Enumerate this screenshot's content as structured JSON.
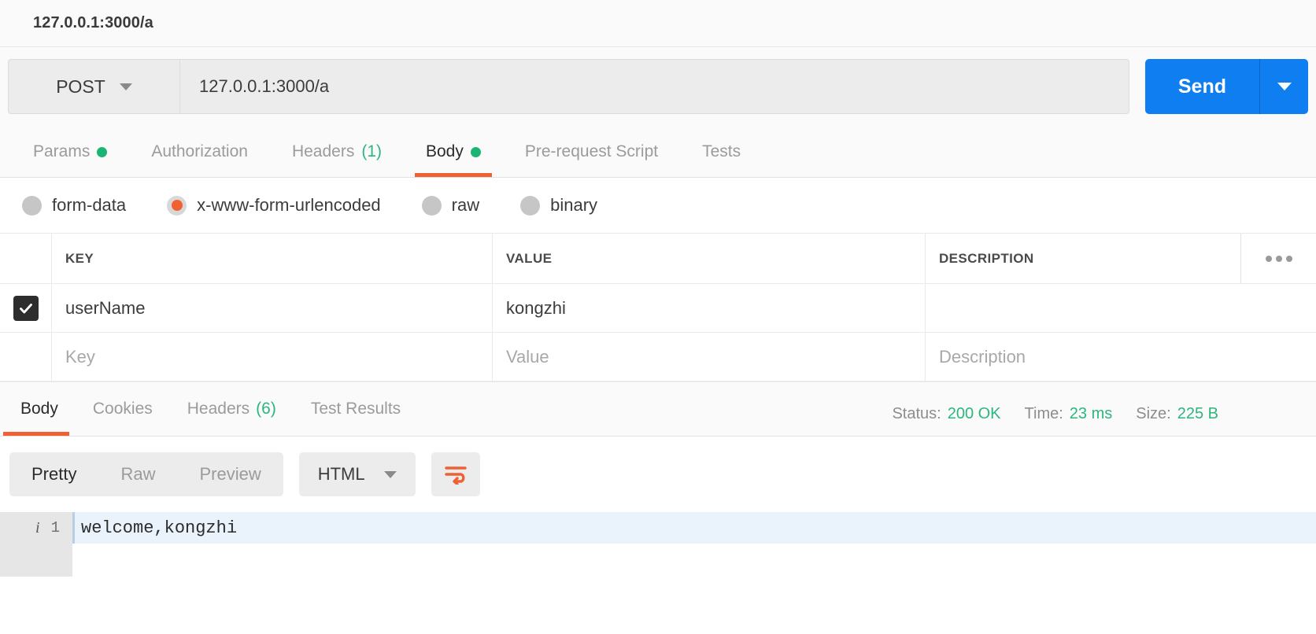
{
  "titlebar": {
    "text": "127.0.0.1:3000/a"
  },
  "request": {
    "method": "POST",
    "url": "127.0.0.1:3000/a",
    "send_label": "Send",
    "tabs": [
      {
        "label": "Params",
        "dot": true,
        "count": "",
        "active": false
      },
      {
        "label": "Authorization",
        "dot": false,
        "count": "",
        "active": false
      },
      {
        "label": "Headers",
        "dot": false,
        "count": "(1)",
        "active": false
      },
      {
        "label": "Body",
        "dot": true,
        "count": "",
        "active": true
      },
      {
        "label": "Pre-request Script",
        "dot": false,
        "count": "",
        "active": false
      },
      {
        "label": "Tests",
        "dot": false,
        "count": "",
        "active": false
      }
    ],
    "body_types": [
      {
        "label": "form-data",
        "selected": false
      },
      {
        "label": "x-www-form-urlencoded",
        "selected": true
      },
      {
        "label": "raw",
        "selected": false
      },
      {
        "label": "binary",
        "selected": false
      }
    ],
    "table": {
      "headers": {
        "key": "KEY",
        "value": "VALUE",
        "description": "DESCRIPTION"
      },
      "rows": [
        {
          "checked": true,
          "key": "userName",
          "value": "kongzhi",
          "description": ""
        }
      ],
      "placeholders": {
        "key": "Key",
        "value": "Value",
        "description": "Description"
      }
    }
  },
  "response": {
    "tabs": [
      {
        "label": "Body",
        "count": "",
        "active": true
      },
      {
        "label": "Cookies",
        "count": "",
        "active": false
      },
      {
        "label": "Headers",
        "count": "(6)",
        "active": false
      },
      {
        "label": "Test Results",
        "count": "",
        "active": false
      }
    ],
    "meta": {
      "status_label": "Status:",
      "status_value": "200 OK",
      "time_label": "Time:",
      "time_value": "23 ms",
      "size_label": "Size:",
      "size_value": "225 B"
    },
    "view_modes": [
      {
        "label": "Pretty",
        "active": true
      },
      {
        "label": "Raw",
        "active": false
      },
      {
        "label": "Preview",
        "active": false
      }
    ],
    "format": "HTML",
    "body_lines": [
      {
        "number": "1",
        "text": "welcome,kongzhi"
      }
    ]
  },
  "colors": {
    "accent_orange": "#ef6033",
    "send_blue": "#0f7ef1",
    "status_green": "#2cb67d"
  }
}
